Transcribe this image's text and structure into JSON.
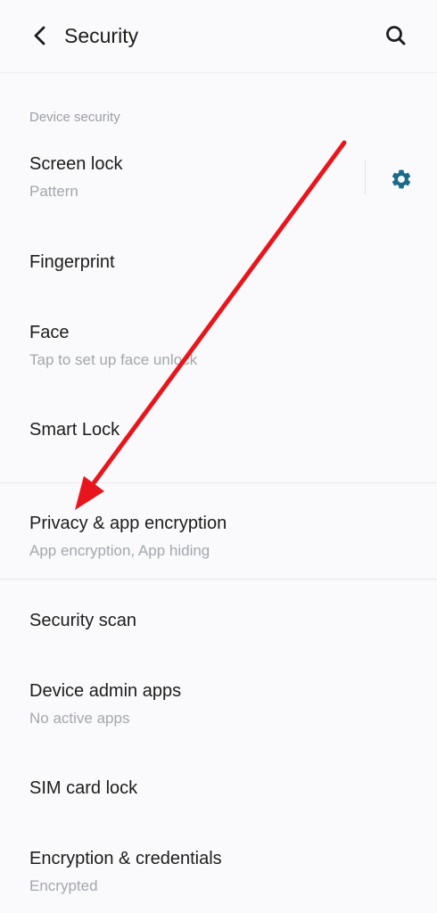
{
  "header": {
    "title": "Security",
    "back_icon": "chevron-left-icon",
    "search_icon": "search-icon"
  },
  "sections": {
    "device_security": {
      "header": "Device security",
      "items": [
        {
          "title": "Screen lock",
          "subtitle": "Pattern"
        },
        {
          "title": "Fingerprint"
        },
        {
          "title": "Face",
          "subtitle": "Tap to set up face unlock"
        },
        {
          "title": "Smart Lock"
        }
      ]
    },
    "privacy": {
      "items": [
        {
          "title": "Privacy & app encryption",
          "subtitle": "App encryption, App hiding"
        }
      ]
    },
    "other": {
      "items": [
        {
          "title": "Security scan"
        },
        {
          "title": "Device admin apps",
          "subtitle": "No active apps"
        },
        {
          "title": "SIM card lock"
        },
        {
          "title": "Encryption & credentials",
          "subtitle": "Encrypted"
        }
      ]
    }
  },
  "colors": {
    "accent": "#1a6a8a",
    "annotation_arrow": "#e8161c",
    "background": "#fafafc",
    "subtitle": "#a4a7ab"
  }
}
